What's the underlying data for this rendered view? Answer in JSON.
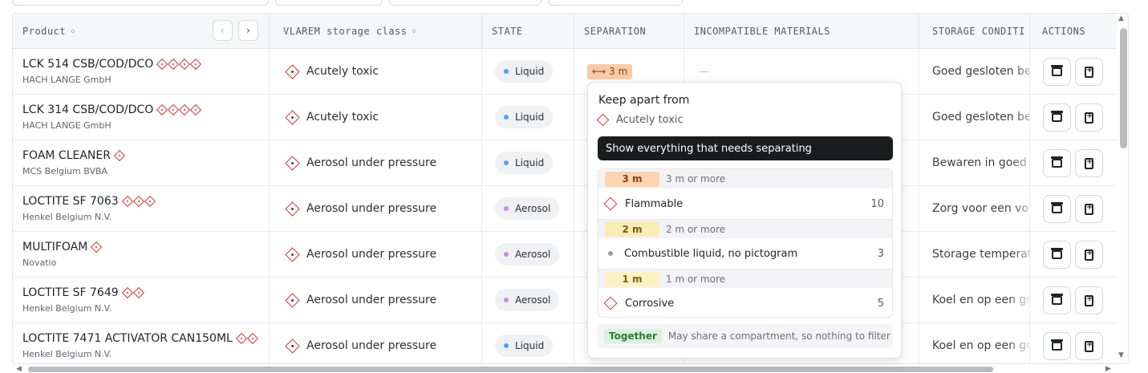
{
  "table": {
    "headers": {
      "product": "Product",
      "vlarem": "VLAREM storage class",
      "state": "STATE",
      "separation": "SEPARATION",
      "incompatible": "INCOMPATIBLE MATERIALS",
      "storage": "STORAGE CONDITI",
      "actions": "ACTIONS"
    },
    "nav": {
      "prev": "‹",
      "next": "›"
    },
    "rows": [
      {
        "name": "LCK 514 CSB/COD/DCO",
        "maker": "HACH LANGE GmbH",
        "vlarem": "Acutely toxic",
        "state": "Liquid",
        "separation": "⟷ 3 m",
        "incompatible": "—",
        "storage": "Goed gesloten bew"
      },
      {
        "name": "LCK 314 CSB/COD/DCO",
        "maker": "HACH LANGE GmbH",
        "vlarem": "Acutely toxic",
        "state": "Liquid",
        "storage": "Goed gesloten bew"
      },
      {
        "name": "FOAM CLEANER",
        "maker": "MCS Belgium BVBA",
        "vlarem": "Aerosol under pressure",
        "state": "Liquid",
        "storage": "Bewaren in goed g"
      },
      {
        "name": "LOCTITE SF 7063",
        "maker": "Henkel Belgium N.V.",
        "vlarem": "Aerosol under pressure",
        "state": "Aerosol",
        "storage": "Zorg voor een volc"
      },
      {
        "name": "MULTIFOAM",
        "maker": "Novatio",
        "vlarem": "Aerosol under pressure",
        "state": "Aerosol",
        "storage": "Storage temperatu"
      },
      {
        "name": "LOCTITE SF 7649",
        "maker": "Henkel Belgium N.V.",
        "vlarem": "Aerosol under pressure",
        "state": "Aerosol",
        "storage": "Koel en op een go"
      },
      {
        "name": "LOCTITE 7471 ACTIVATOR CAN150ML",
        "maker": "Henkel Belgium N.V.",
        "vlarem": "Aerosol under pressure",
        "state": "Liquid",
        "storage": "Koel en op een go"
      }
    ]
  },
  "colors": {
    "liquid_dot": "#5b9bf0",
    "aerosol_dot": "#c98ae8"
  },
  "popover": {
    "title": "Keep apart from",
    "subtitle": "Acutely toxic",
    "button": "Show everything that needs separating",
    "groups": [
      {
        "badge": "3 m",
        "desc": "3 m or more",
        "bg": "#fbd4b0",
        "fg": "#8a3d0c",
        "items": [
          {
            "label": "Flammable",
            "count": "10",
            "icon": "flame-pictogram"
          }
        ]
      },
      {
        "badge": "2 m",
        "desc": "2 m or more",
        "bg": "#fbecb8",
        "fg": "#7a5a06",
        "items": [
          {
            "label": "Combustible liquid, no pictogram",
            "count": "3",
            "icon": "dot"
          }
        ]
      },
      {
        "badge": "1 m",
        "desc": "1 m or more",
        "bg": "#fcf2c4",
        "fg": "#7a6406",
        "items": [
          {
            "label": "Corrosive",
            "count": "5",
            "icon": "corrosion-pictogram"
          }
        ]
      }
    ],
    "together": {
      "badge": "Together",
      "desc": "May share a compartment, so nothing to filter"
    }
  }
}
